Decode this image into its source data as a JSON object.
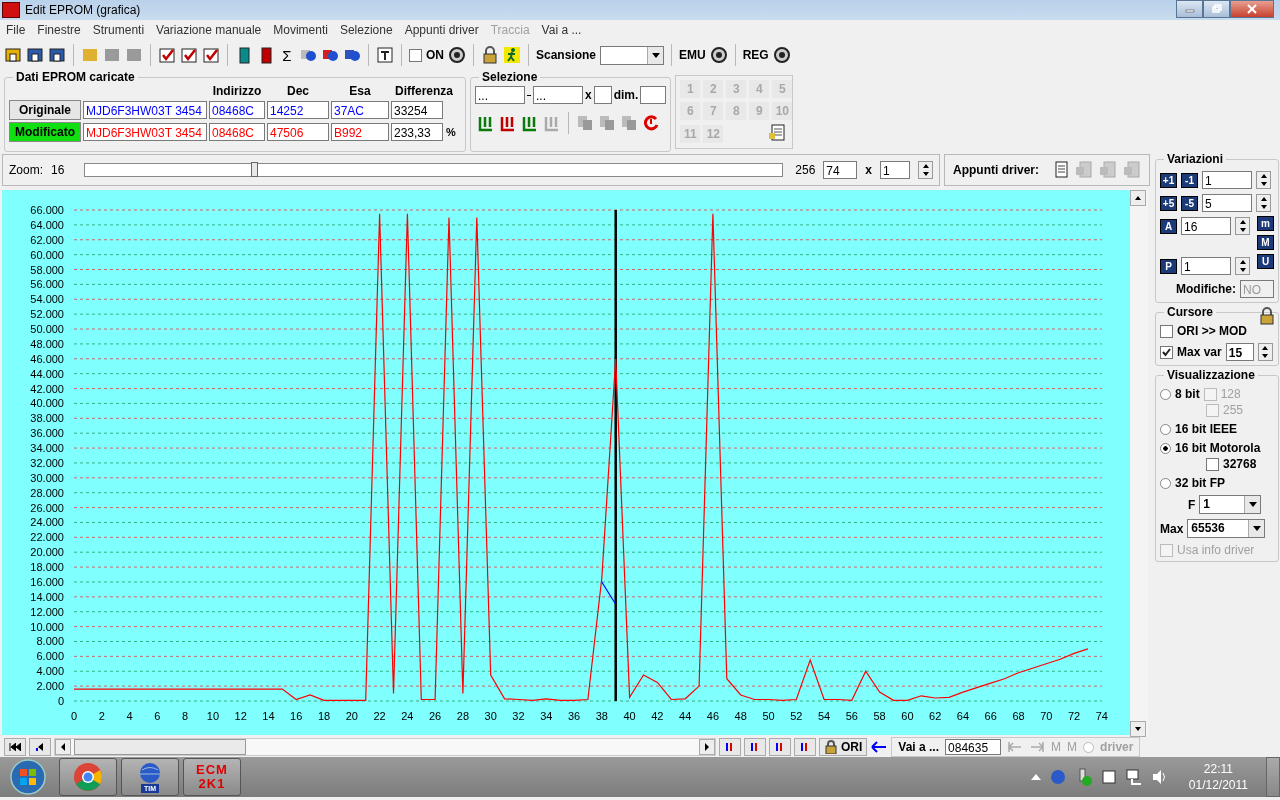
{
  "window": {
    "title": "Edit EPROM (grafica)"
  },
  "menu": [
    {
      "label": "File",
      "disabled": false
    },
    {
      "label": "Finestre",
      "disabled": false
    },
    {
      "label": "Strumenti",
      "disabled": false
    },
    {
      "label": "Variazione manuale",
      "disabled": false
    },
    {
      "label": "Movimenti",
      "disabled": false
    },
    {
      "label": "Selezione",
      "disabled": false
    },
    {
      "label": "Appunti driver",
      "disabled": false
    },
    {
      "label": "Traccia",
      "disabled": true
    },
    {
      "label": "Vai a ...",
      "disabled": false
    }
  ],
  "toolbar": {
    "sum_symbol": "Σ",
    "on_label": "ON",
    "on_checked": false,
    "scan_label": "Scansione",
    "emu_label": "EMU",
    "reg_label": "REG"
  },
  "loaded_data": {
    "title": "Dati EPROM caricate",
    "columns": [
      "Indirizzo",
      "Dec",
      "Esa",
      "Differenza"
    ],
    "rows": [
      {
        "label": "Originale",
        "selected": false,
        "color": "#0000ff",
        "file": "MJD6F3HW03T 3454",
        "address": "08468C",
        "dec": "14252",
        "hex": "37AC",
        "diff": "33254"
      },
      {
        "label": "Modificato",
        "selected": true,
        "color": "#ff0000",
        "file": "MJD6F3HW03T 3454",
        "address": "08468C",
        "dec": "47506",
        "hex": "B992",
        "diff": "233,33",
        "unit": "%"
      }
    ]
  },
  "selection": {
    "title": "Selezione",
    "from": "...",
    "to": "...",
    "x_label": "x",
    "dim_label": "dim."
  },
  "slots": [
    {
      "label": "1",
      "disabled": true
    },
    {
      "label": "2",
      "disabled": true
    },
    {
      "label": "3",
      "disabled": true
    },
    {
      "label": "4",
      "disabled": true
    },
    {
      "label": "5",
      "disabled": true
    },
    {
      "label": "6",
      "disabled": true
    },
    {
      "label": "7",
      "disabled": true
    },
    {
      "label": "8",
      "disabled": true
    },
    {
      "label": "9",
      "disabled": true
    },
    {
      "label": "10",
      "disabled": true
    },
    {
      "label": "11",
      "disabled": true
    },
    {
      "label": "12",
      "disabled": true
    }
  ],
  "zoom": {
    "label": "Zoom:",
    "min": "16",
    "max": "256",
    "level": 0.244,
    "value": "74",
    "x_label": "x",
    "factor": "1"
  },
  "clipboard": {
    "label": "Appunti driver:"
  },
  "chart_data": {
    "type": "line",
    "x": [
      0,
      1,
      2,
      3,
      4,
      5,
      6,
      7,
      8,
      9,
      10,
      11,
      12,
      13,
      14,
      15,
      16,
      17,
      18,
      19,
      20,
      21,
      22,
      23,
      24,
      25,
      26,
      27,
      28,
      29,
      30,
      31,
      32,
      33,
      34,
      35,
      36,
      37,
      38,
      39,
      40,
      41,
      42,
      43,
      44,
      45,
      46,
      47,
      48,
      49,
      50,
      51,
      52,
      53,
      54,
      55,
      56,
      57,
      58,
      59,
      60,
      61,
      62,
      63,
      64,
      65,
      66,
      67,
      68,
      69,
      70,
      71,
      72,
      73
    ],
    "series": [
      {
        "color": "#0000ff",
        "values": [
          null,
          null,
          null,
          null,
          null,
          null,
          null,
          null,
          null,
          null,
          null,
          null,
          null,
          null,
          null,
          null,
          null,
          null,
          null,
          null,
          null,
          null,
          null,
          null,
          null,
          null,
          null,
          null,
          null,
          null,
          null,
          null,
          null,
          null,
          null,
          null,
          null,
          null,
          16000,
          13000,
          null,
          null,
          null,
          null,
          null,
          null,
          null,
          null,
          null,
          null,
          null,
          null,
          null,
          null,
          null,
          null,
          null,
          null,
          null,
          null,
          null,
          null,
          null,
          null,
          null,
          null,
          null,
          null,
          null,
          null,
          null,
          null,
          null,
          null
        ]
      },
      {
        "color": "#ff0000",
        "values": [
          1600,
          1600,
          1600,
          1600,
          1600,
          1600,
          1600,
          1600,
          1600,
          1600,
          1600,
          1600,
          1600,
          1600,
          1600,
          1600,
          200,
          800,
          100,
          100,
          100,
          100,
          65500,
          1000,
          65500,
          200,
          200,
          65000,
          1000,
          65000,
          3500,
          300,
          200,
          100,
          300,
          100,
          100,
          200,
          16500,
          46000,
          500,
          3500,
          2500,
          200,
          300,
          2000,
          65500,
          3000,
          800,
          200,
          200,
          100,
          200,
          5500,
          200,
          200,
          100,
          4000,
          1200,
          100,
          100,
          700,
          400,
          500,
          1200,
          1800,
          2400,
          3000,
          3800,
          4400,
          5000,
          5600,
          6400,
          7000
        ]
      }
    ],
    "xlim": [
      0,
      74
    ],
    "ylim": [
      0,
      66000
    ],
    "xticks": [
      0,
      2,
      4,
      6,
      8,
      10,
      12,
      14,
      16,
      18,
      20,
      22,
      24,
      26,
      28,
      30,
      32,
      34,
      36,
      38,
      40,
      42,
      44,
      46,
      48,
      50,
      52,
      54,
      56,
      58,
      60,
      62,
      64,
      66,
      68,
      70,
      72,
      74
    ],
    "yticks": [
      {
        "value": 0,
        "label": "0"
      },
      {
        "value": 2000,
        "label": "2.000"
      },
      {
        "value": 4000,
        "label": "4.000"
      },
      {
        "value": 6000,
        "label": "6.000"
      },
      {
        "value": 8000,
        "label": "8.000"
      },
      {
        "value": 10000,
        "label": "10.000"
      },
      {
        "value": 12000,
        "label": "12.000"
      },
      {
        "value": 14000,
        "label": "14.000"
      },
      {
        "value": 16000,
        "label": "16.000"
      },
      {
        "value": 18000,
        "label": "18.000"
      },
      {
        "value": 20000,
        "label": "20.000"
      },
      {
        "value": 22000,
        "label": "22.000"
      },
      {
        "value": 24000,
        "label": "24.000"
      },
      {
        "value": 26000,
        "label": "26.000"
      },
      {
        "value": 28000,
        "label": "28.000"
      },
      {
        "value": 30000,
        "label": "30.000"
      },
      {
        "value": 32000,
        "label": "32.000"
      },
      {
        "value": 34000,
        "label": "34.000"
      },
      {
        "value": 36000,
        "label": "36.000"
      },
      {
        "value": 38000,
        "label": "38.000"
      },
      {
        "value": 40000,
        "label": "40.000"
      },
      {
        "value": 42000,
        "label": "42.000"
      },
      {
        "value": 44000,
        "label": "44.000"
      },
      {
        "value": 46000,
        "label": "46.000"
      },
      {
        "value": 48000,
        "label": "48.000"
      },
      {
        "value": 50000,
        "label": "50.000"
      },
      {
        "value": 52000,
        "label": "52.000"
      },
      {
        "value": 54000,
        "label": "54.000"
      },
      {
        "value": 56000,
        "label": "56.000"
      },
      {
        "value": 58000,
        "label": "58.000"
      },
      {
        "value": 60000,
        "label": "60.000"
      },
      {
        "value": 62000,
        "label": "62.000"
      },
      {
        "value": 64000,
        "label": "64.000"
      },
      {
        "value": 66000,
        "label": "66.000"
      }
    ],
    "grid": true,
    "ref_lines": [
      {
        "axis": "x",
        "value": 39,
        "color": "#000000"
      }
    ]
  },
  "variations": {
    "title": "Variazioni",
    "step_buttons": [
      "+1",
      "-1"
    ],
    "step_value": "1",
    "step5_buttons": [
      "+5",
      "-5"
    ],
    "step5_value": "5",
    "a_button": "A",
    "a_value": "16",
    "p_button": "P",
    "p_value": "1",
    "side_buttons": [
      "m",
      "M",
      "U"
    ],
    "changes_label": "Modifiche:",
    "changes_value": "NO"
  },
  "cursor": {
    "title": "Cursore",
    "ori_mod": {
      "label": "ORI >> MOD",
      "checked": false
    },
    "max_var": {
      "label": "Max var",
      "checked": true,
      "value": "15"
    }
  },
  "display": {
    "title": "Visualizzazione",
    "modes": [
      {
        "label": "8 bit",
        "selected": false
      },
      {
        "label": "16 bit IEEE",
        "selected": false
      },
      {
        "label": "16 bit Motorola",
        "selected": true
      },
      {
        "label": "32 bit FP",
        "selected": false
      }
    ],
    "opt_128": {
      "label": "128",
      "checked": false,
      "disabled": true
    },
    "opt_255": {
      "label": "255",
      "checked": false,
      "disabled": true
    },
    "opt_32768": {
      "label": "32768",
      "checked": false,
      "disabled": false
    },
    "f_label": "F",
    "f_value": "1",
    "max_label": "Max",
    "max_value": "65536",
    "driver_info": {
      "label": "Usa info driver",
      "checked": false,
      "disabled": true
    }
  },
  "bottom_bar": {
    "ori_label": "ORI",
    "goto_title": "Vai a ...",
    "goto_value": "084635",
    "marks": [
      "M",
      "M"
    ],
    "driver_label": "driver",
    "driver_selected": false
  },
  "taskbar": {
    "tim_label": "TIM",
    "logo_top": "ECM",
    "logo_bottom": "2K1",
    "time": "22:11",
    "date": "01/12/2011"
  }
}
